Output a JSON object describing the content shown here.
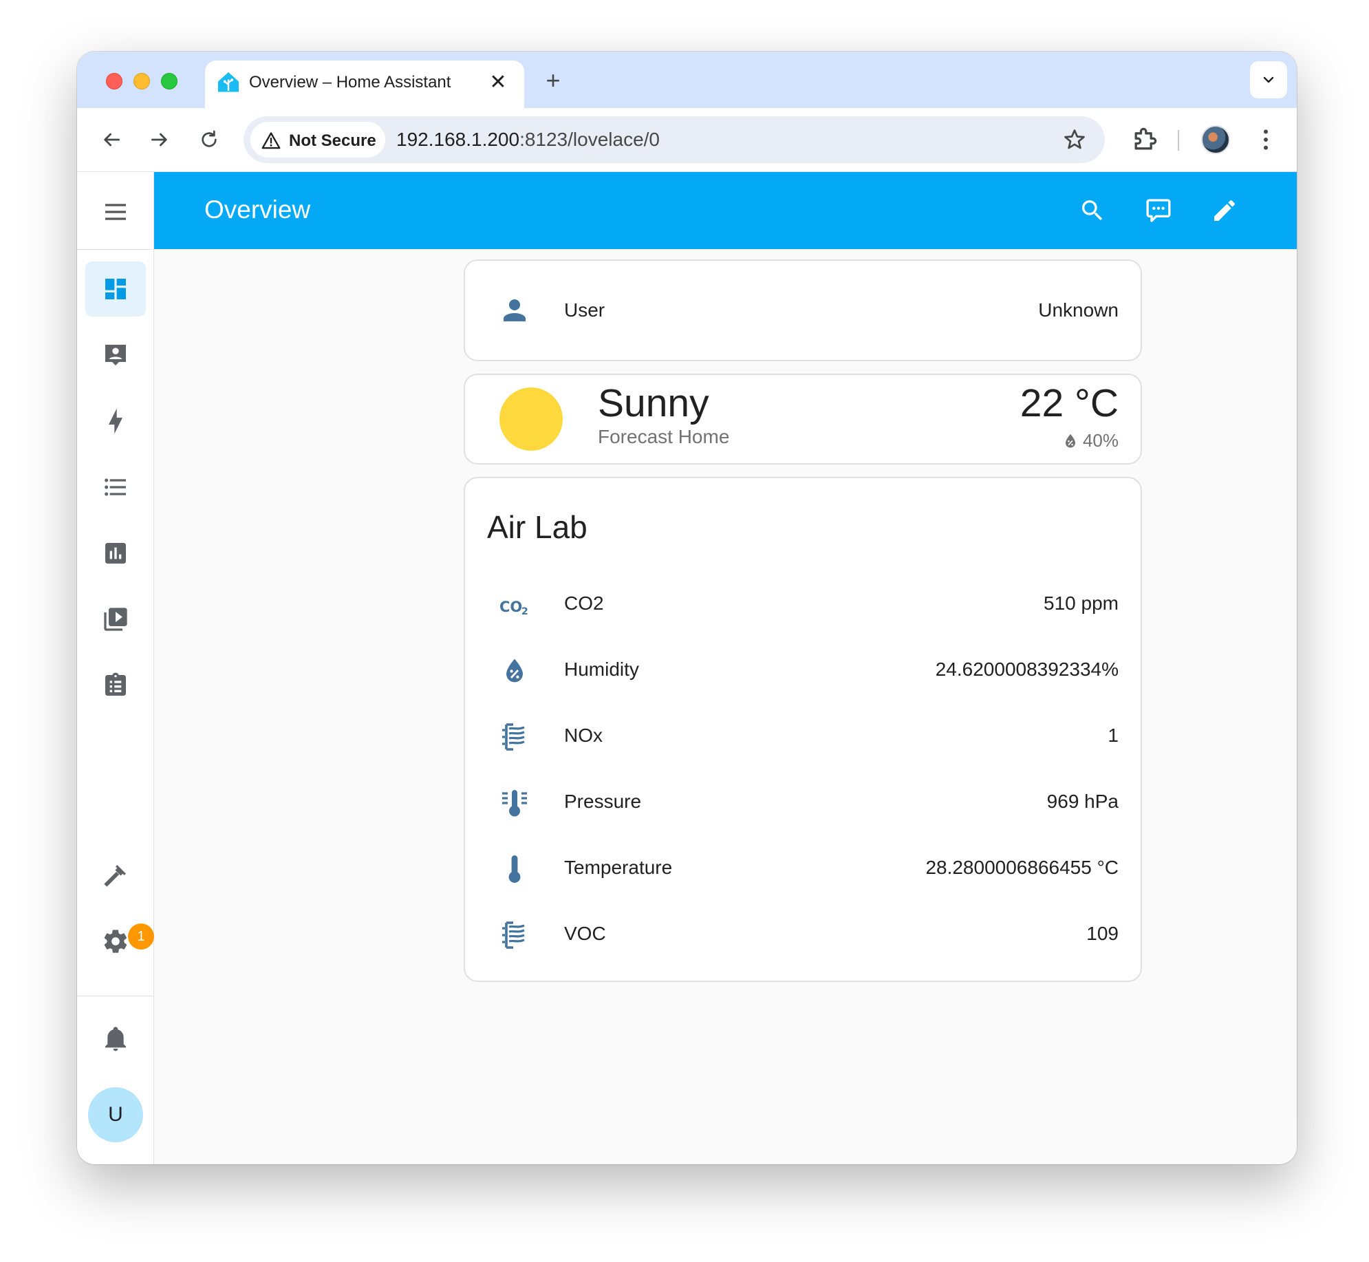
{
  "browser": {
    "tab_title": "Overview – Home Assistant",
    "tab_close": "✕",
    "new_tab": "+",
    "security_label": "Not Secure",
    "url_host": "192.168.1.200",
    "url_path": ":8123/lovelace/0"
  },
  "header": {
    "title": "Overview"
  },
  "sidebar": {
    "items": [
      {
        "name": "overview",
        "icon": "dashboard-icon",
        "active": true
      },
      {
        "name": "map",
        "icon": "account-box-icon"
      },
      {
        "name": "energy",
        "icon": "lightning-icon"
      },
      {
        "name": "logbook",
        "icon": "format-list-icon"
      },
      {
        "name": "history",
        "icon": "chart-box-icon"
      },
      {
        "name": "media",
        "icon": "play-box-multiple-icon"
      },
      {
        "name": "todo",
        "icon": "clipboard-list-icon"
      }
    ],
    "settings_badge": "1",
    "avatar_initial": "U"
  },
  "user_card": {
    "name": "User",
    "state": "Unknown"
  },
  "weather_card": {
    "condition": "Sunny",
    "name": "Forecast Home",
    "temperature": "22 °C",
    "humidity": "40%"
  },
  "air_card": {
    "title": "Air Lab",
    "rows": [
      {
        "name": "CO2",
        "value": "510 ppm",
        "icon": "molecule-co2-icon"
      },
      {
        "name": "Humidity",
        "value": "24.6200008392334%",
        "icon": "water-percent-icon"
      },
      {
        "name": "NOx",
        "value": "1",
        "icon": "air-filter-icon"
      },
      {
        "name": "Pressure",
        "value": "969 hPa",
        "icon": "thermometer-lines-icon"
      },
      {
        "name": "Temperature",
        "value": "28.2800006866455 °C",
        "icon": "thermometer-icon"
      },
      {
        "name": "VOC",
        "value": "109",
        "icon": "air-filter-icon"
      }
    ]
  },
  "colors": {
    "header": "#03a9f4",
    "icon": "#44739e",
    "sun": "#fdd93d",
    "badge": "#ff9800"
  }
}
